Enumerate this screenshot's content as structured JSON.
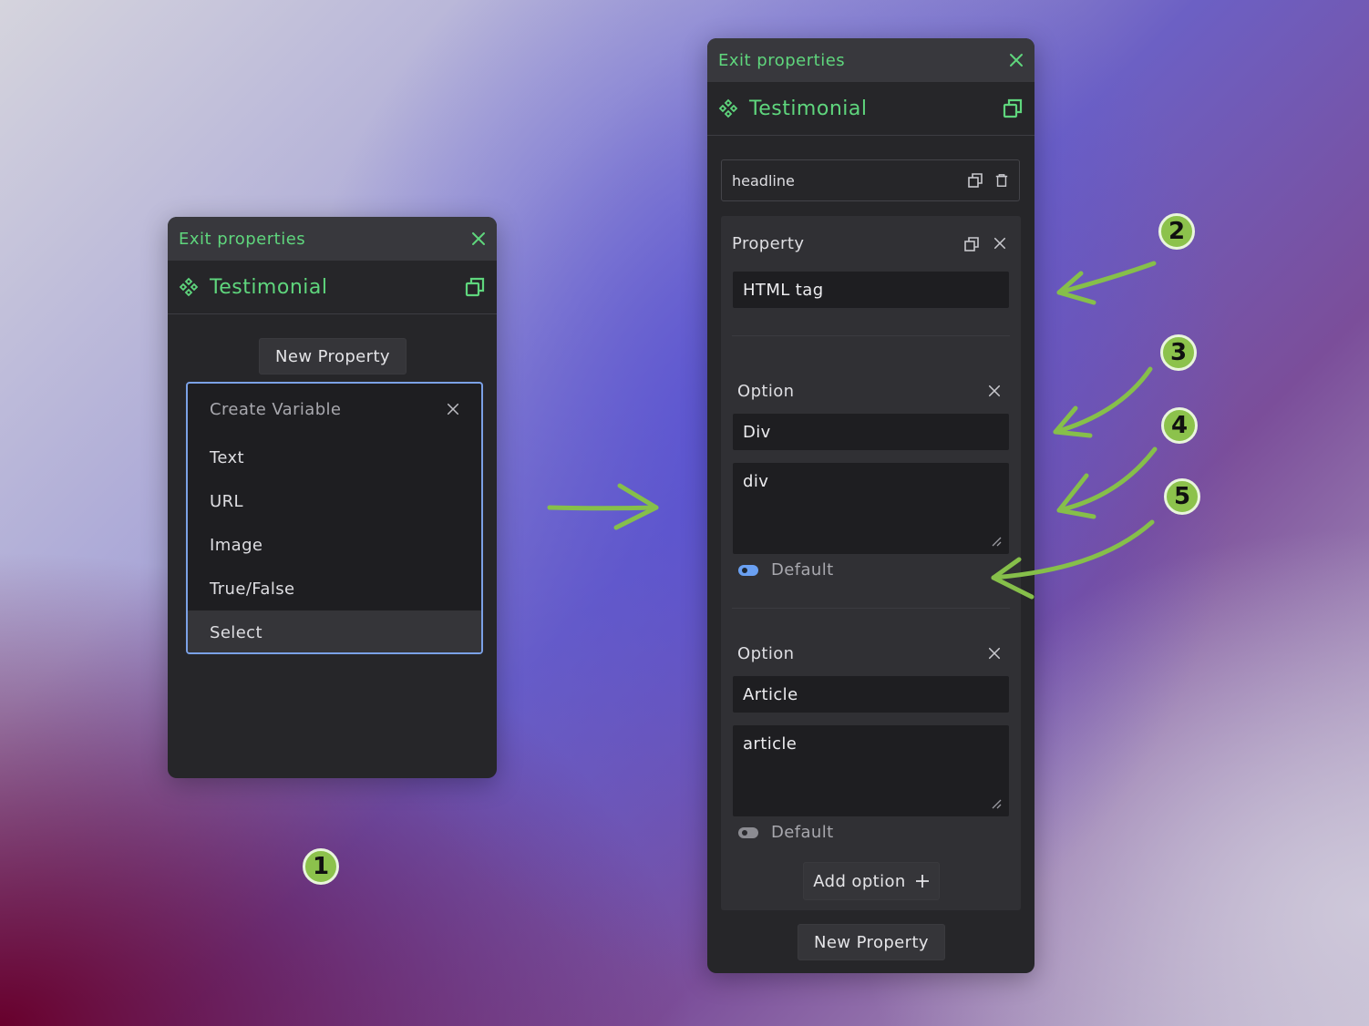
{
  "left_panel": {
    "exit_label": "Exit properties",
    "title": "Testimonial",
    "new_property": "New Property",
    "dropdown": {
      "header": "Create Variable",
      "items": [
        "Text",
        "URL",
        "Image",
        "True/False",
        "Select"
      ],
      "selected": "Select"
    }
  },
  "right_panel": {
    "exit_label": "Exit properties",
    "title": "Testimonial",
    "headline_value": "headline",
    "property": {
      "label": "Property",
      "value": "HTML tag"
    },
    "options": [
      {
        "label": "Option",
        "name": "Div",
        "value": "div",
        "default_label": "Default",
        "default_on": true
      },
      {
        "label": "Option",
        "name": "Article",
        "value": "article",
        "default_label": "Default",
        "default_on": false
      }
    ],
    "add_option": "Add option",
    "new_property": "New Property"
  },
  "annotations": [
    "1",
    "2",
    "3",
    "4",
    "5"
  ],
  "colors": {
    "accent_green": "#5fd67d",
    "panel_bg": "#262629",
    "header_bg": "#38383d",
    "arrow_green": "#86bf4a",
    "select_border": "#7ba1e6"
  },
  "icons": [
    "component-icon",
    "duplicate-icon",
    "close-icon",
    "copy-icon",
    "trash-icon",
    "plus-icon",
    "resize-handle-icon"
  ]
}
